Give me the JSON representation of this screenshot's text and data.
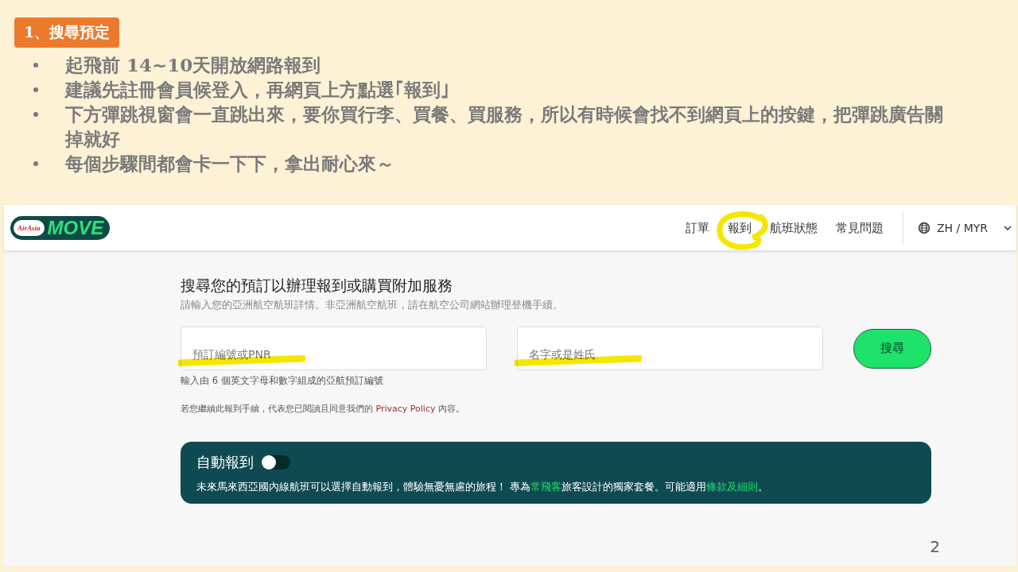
{
  "slide": {
    "heading": "1、搜尋預定",
    "page_number": "2",
    "bullets": [
      "起飛前 14~10天開放網路報到",
      "建議先註冊會員候登入，再網頁上方點選｢報到｣",
      "下方彈跳視窗會一直跳出來，要你買行李、買餐、買服務，所以有時候會找不到網頁上的按鍵，把彈跳廣告關掉就好",
      "每個步驟間都會卡一下下，拿出耐心來～"
    ]
  },
  "site": {
    "logo": {
      "badge": "AirAsia",
      "name": "MOVE"
    },
    "nav": [
      {
        "label": "訂單",
        "highlighted": false
      },
      {
        "label": "報到",
        "highlighted": true
      },
      {
        "label": "航班狀態",
        "highlighted": false
      },
      {
        "label": "常見問題",
        "highlighted": false
      }
    ],
    "locale": "ZH / MYR",
    "form": {
      "title": "搜尋您的預訂以辦理報到或購買附加服務",
      "subtitle": "請輸入您的亞洲航空航班詳情。非亞洲航空航班，請在航空公司網站辦理登機手續。",
      "fields": [
        {
          "placeholder": "預訂編號或PNR",
          "highlighted": true
        },
        {
          "placeholder": "名字或是姓氏",
          "highlighted": true
        }
      ],
      "button": "搜尋",
      "hint": "輸入由 6 個英文字母和數字組成的亞航預訂編號",
      "consent": [
        {
          "kind": "plain",
          "text": "若您繼續此報到手續，代表您已閱讀且同意我們的 "
        },
        {
          "kind": "link",
          "text": "Privacy Policy"
        },
        {
          "kind": "plain",
          "text": " 內容。"
        }
      ]
    },
    "auto_checkin": {
      "title": "自動報到",
      "on": false,
      "text": [
        {
          "kind": "plain",
          "text": "未來馬來西亞國內線航班可以選擇自動報到，體驗無憂無慮的旅程！ 專為"
        },
        {
          "kind": "link",
          "text": "常飛客"
        },
        {
          "kind": "plain",
          "text": "旅客設計的獨家套餐。可能適用"
        },
        {
          "kind": "link",
          "text": "條款及細則"
        },
        {
          "kind": "plain",
          "text": "。"
        }
      ]
    }
  }
}
